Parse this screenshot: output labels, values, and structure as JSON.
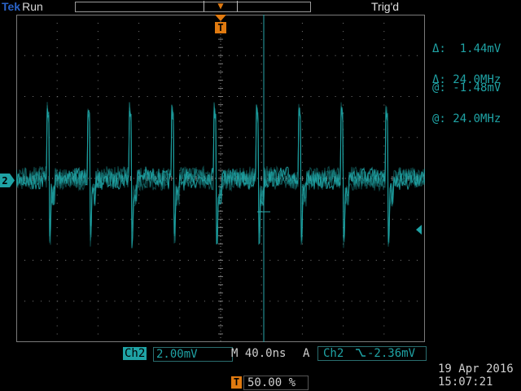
{
  "header": {
    "brand": "Tek",
    "run_state": "Run",
    "trigger_status": "Trig'd"
  },
  "markers": {
    "channel_marker": "2",
    "trigger_marker": "T"
  },
  "cursors": {
    "amplitude": {
      "delta_symbol": "Δ:",
      "delta_value": "1.44mV",
      "at_symbol": "@:",
      "at_value": "-1.48mV"
    },
    "frequency": {
      "delta_symbol": "Δ:",
      "delta_value": "24.0MHz",
      "at_symbol": "@:",
      "at_value": "24.0MHz"
    }
  },
  "status": {
    "channel_label": "Ch2",
    "vertical_scale": "2.00mV",
    "timebase_label": "M",
    "timebase_value": "40.0ns",
    "acquisition_mode": "A",
    "trigger_source": "Ch2",
    "trigger_slope_icon": "falling-edge-icon",
    "trigger_level": "-2.36mV",
    "trigger_position_icon": "T",
    "trigger_position": "50.00 %",
    "date": "19 Apr 2016",
    "time": "15:07:21"
  },
  "colors": {
    "trace": "#1fa3a5",
    "trigger_marker": "#e07a10",
    "brand": "#2a63c8",
    "graticule": "#7a7a7a"
  },
  "waveform": {
    "spike_count": 9,
    "time_per_division_ns": 40,
    "volts_per_division_mV": 2
  }
}
